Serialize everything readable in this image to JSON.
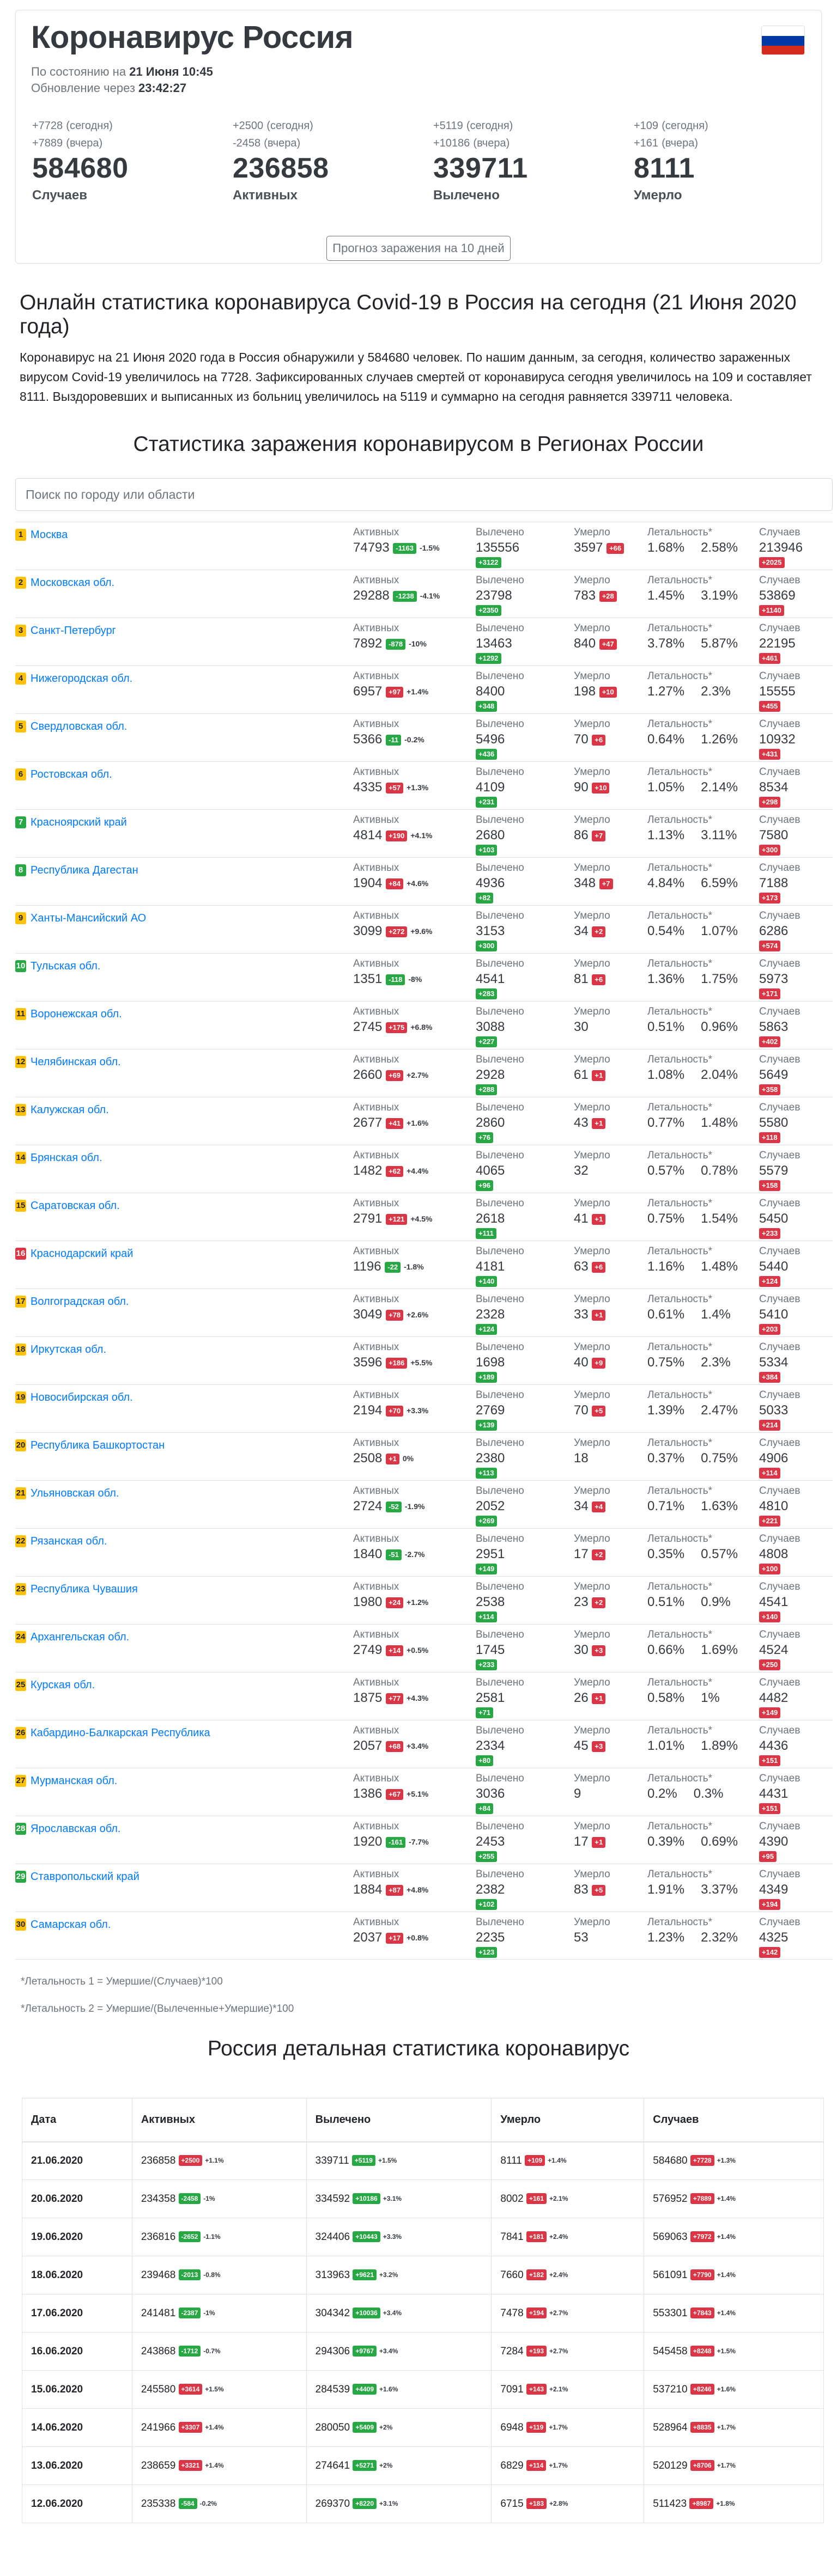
{
  "header": {
    "title": "Коронавирус Россия",
    "asof_label": "По состоянию на",
    "asof_value": "21 Июня 10:45",
    "update_label": "Обновление через",
    "update_value": "23:42:27"
  },
  "stats": [
    {
      "today": "+7728",
      "today_lbl": "(сегодня)",
      "yest": "+7889",
      "yest_lbl": "(вчера)",
      "total": "584680",
      "label": "Случаев",
      "color": "#212529"
    },
    {
      "today": "+2500",
      "today_lbl": "(сегодня)",
      "yest": "-2458",
      "yest_lbl": "(вчера)",
      "total": "236858",
      "label": "Активных",
      "color": "#17a2b8"
    },
    {
      "today": "+5119",
      "today_lbl": "(сегодня)",
      "yest": "+10186",
      "yest_lbl": "(вчера)",
      "total": "339711",
      "label": "Вылечено",
      "color": "#28a745"
    },
    {
      "today": "+109",
      "today_lbl": "(сегодня)",
      "yest": "+161",
      "yest_lbl": "(вчера)",
      "total": "8111",
      "label": "Умерло",
      "color": "#dc3545"
    }
  ],
  "forecast_button": "Прогноз заражения на 10 дней",
  "online_title": "Онлайн статистика коронавируса Covid-19 в Россия на сегодня (21 Июня 2020 года)",
  "intro": "Коронавирус на 21 Июня 2020 года в Россия обнаружили у 584680 человек. По нашим данным, за сегодня, количество зараженных вирусом Covid-19 увеличилось на 7728. Зафиксированных случаев смертей от коронавируса сегодня увеличилось на 109 и составляет 8111. Выздоровевших и выписанных из больниц увеличилось на 5119 и суммарно на сегодня равняется 339711 человека.",
  "regions_title": "Статистика заражения коронавирусом в Регионах России",
  "search_placeholder": "Поиск по городу или области",
  "col_labels": {
    "active": "Активных",
    "recovered": "Вылечено",
    "died": "Умерло",
    "lethality": "Летальность*",
    "cases": "Случаев"
  },
  "regions": [
    {
      "n": "1",
      "name": "Москва",
      "a": "74793",
      "ad": "-1163",
      "ap": "-1.5%",
      "r": "135556",
      "rd": "+3122",
      "d": "3597",
      "dd": "+66",
      "l1": "1.68%",
      "l2": "2.58%",
      "c": "213946",
      "cd": "+2025"
    },
    {
      "n": "2",
      "name": "Московская обл.",
      "a": "29288",
      "ad": "-1238",
      "ap": "-4.1%",
      "r": "23798",
      "rd": "+2350",
      "d": "783",
      "dd": "+28",
      "l1": "1.45%",
      "l2": "3.19%",
      "c": "53869",
      "cd": "+1140"
    },
    {
      "n": "3",
      "name": "Санкт-Петербург",
      "a": "7892",
      "ad": "-878",
      "ap": "-10%",
      "r": "13463",
      "rd": "+1292",
      "d": "840",
      "dd": "+47",
      "l1": "3.78%",
      "l2": "5.87%",
      "c": "22195",
      "cd": "+461"
    },
    {
      "n": "4",
      "name": "Нижегородская обл.",
      "a": "6957",
      "ad": "+97",
      "ap": "+1.4%",
      "r": "8400",
      "rd": "+348",
      "d": "198",
      "dd": "+10",
      "l1": "1.27%",
      "l2": "2.3%",
      "c": "15555",
      "cd": "+455"
    },
    {
      "n": "5",
      "name": "Свердловская обл.",
      "a": "5366",
      "ad": "-11",
      "ap": "-0.2%",
      "r": "5496",
      "rd": "+436",
      "d": "70",
      "dd": "+6",
      "l1": "0.64%",
      "l2": "1.26%",
      "c": "10932",
      "cd": "+431"
    },
    {
      "n": "6",
      "name": "Ростовская обл.",
      "a": "4335",
      "ad": "+57",
      "ap": "+1.3%",
      "r": "4109",
      "rd": "+231",
      "d": "90",
      "dd": "+10",
      "l1": "1.05%",
      "l2": "2.14%",
      "c": "8534",
      "cd": "+298"
    },
    {
      "n": "7",
      "name": "Красноярский край",
      "a": "4814",
      "ad": "+190",
      "ap": "+4.1%",
      "r": "2680",
      "rd": "+103",
      "d": "86",
      "dd": "+7",
      "l1": "1.13%",
      "l2": "3.11%",
      "c": "7580",
      "cd": "+300"
    },
    {
      "n": "8",
      "name": "Республика Дагестан",
      "a": "1904",
      "ad": "+84",
      "ap": "+4.6%",
      "r": "4936",
      "rd": "+82",
      "d": "348",
      "dd": "+7",
      "l1": "4.84%",
      "l2": "6.59%",
      "c": "7188",
      "cd": "+173"
    },
    {
      "n": "9",
      "name": "Ханты-Мансийский АО",
      "a": "3099",
      "ad": "+272",
      "ap": "+9.6%",
      "r": "3153",
      "rd": "+300",
      "d": "34",
      "dd": "+2",
      "l1": "0.54%",
      "l2": "1.07%",
      "c": "6286",
      "cd": "+574"
    },
    {
      "n": "10",
      "name": "Тульская обл.",
      "a": "1351",
      "ad": "-118",
      "ap": "-8%",
      "r": "4541",
      "rd": "+283",
      "d": "81",
      "dd": "+6",
      "l1": "1.36%",
      "l2": "1.75%",
      "c": "5973",
      "cd": "+171"
    },
    {
      "n": "11",
      "name": "Воронежская обл.",
      "a": "2745",
      "ad": "+175",
      "ap": "+6.8%",
      "r": "3088",
      "rd": "+227",
      "d": "30",
      "dd": "",
      "l1": "0.51%",
      "l2": "0.96%",
      "c": "5863",
      "cd": "+402"
    },
    {
      "n": "12",
      "name": "Челябинская обл.",
      "a": "2660",
      "ad": "+69",
      "ap": "+2.7%",
      "r": "2928",
      "rd": "+288",
      "d": "61",
      "dd": "+1",
      "l1": "1.08%",
      "l2": "2.04%",
      "c": "5649",
      "cd": "+358"
    },
    {
      "n": "13",
      "name": "Калужская обл.",
      "a": "2677",
      "ad": "+41",
      "ap": "+1.6%",
      "r": "2860",
      "rd": "+76",
      "d": "43",
      "dd": "+1",
      "l1": "0.77%",
      "l2": "1.48%",
      "c": "5580",
      "cd": "+118"
    },
    {
      "n": "14",
      "name": "Брянская обл.",
      "a": "1482",
      "ad": "+62",
      "ap": "+4.4%",
      "r": "4065",
      "rd": "+96",
      "d": "32",
      "dd": "",
      "l1": "0.57%",
      "l2": "0.78%",
      "c": "5579",
      "cd": "+158"
    },
    {
      "n": "15",
      "name": "Саратовская обл.",
      "a": "2791",
      "ad": "+121",
      "ap": "+4.5%",
      "r": "2618",
      "rd": "+111",
      "d": "41",
      "dd": "+1",
      "l1": "0.75%",
      "l2": "1.54%",
      "c": "5450",
      "cd": "+233"
    },
    {
      "n": "16",
      "name": "Краснодарский край",
      "a": "1196",
      "ad": "-22",
      "ap": "-1.8%",
      "r": "4181",
      "rd": "+140",
      "d": "63",
      "dd": "+6",
      "l1": "1.16%",
      "l2": "1.48%",
      "c": "5440",
      "cd": "+124"
    },
    {
      "n": "17",
      "name": "Волгоградская обл.",
      "a": "3049",
      "ad": "+78",
      "ap": "+2.6%",
      "r": "2328",
      "rd": "+124",
      "d": "33",
      "dd": "+1",
      "l1": "0.61%",
      "l2": "1.4%",
      "c": "5410",
      "cd": "+203"
    },
    {
      "n": "18",
      "name": "Иркутская обл.",
      "a": "3596",
      "ad": "+186",
      "ap": "+5.5%",
      "r": "1698",
      "rd": "+189",
      "d": "40",
      "dd": "+9",
      "l1": "0.75%",
      "l2": "2.3%",
      "c": "5334",
      "cd": "+384"
    },
    {
      "n": "19",
      "name": "Новосибирская обл.",
      "a": "2194",
      "ad": "+70",
      "ap": "+3.3%",
      "r": "2769",
      "rd": "+139",
      "d": "70",
      "dd": "+5",
      "l1": "1.39%",
      "l2": "2.47%",
      "c": "5033",
      "cd": "+214"
    },
    {
      "n": "20",
      "name": "Республика Башкортостан",
      "a": "2508",
      "ad": "+1",
      "ap": "0%",
      "r": "2380",
      "rd": "+113",
      "d": "18",
      "dd": "",
      "l1": "0.37%",
      "l2": "0.75%",
      "c": "4906",
      "cd": "+114"
    },
    {
      "n": "21",
      "name": "Ульяновская обл.",
      "a": "2724",
      "ad": "-52",
      "ap": "-1.9%",
      "r": "2052",
      "rd": "+269",
      "d": "34",
      "dd": "+4",
      "l1": "0.71%",
      "l2": "1.63%",
      "c": "4810",
      "cd": "+221"
    },
    {
      "n": "22",
      "name": "Рязанская обл.",
      "a": "1840",
      "ad": "-51",
      "ap": "-2.7%",
      "r": "2951",
      "rd": "+149",
      "d": "17",
      "dd": "+2",
      "l1": "0.35%",
      "l2": "0.57%",
      "c": "4808",
      "cd": "+100"
    },
    {
      "n": "23",
      "name": "Республика Чувашия",
      "a": "1980",
      "ad": "+24",
      "ap": "+1.2%",
      "r": "2538",
      "rd": "+114",
      "d": "23",
      "dd": "+2",
      "l1": "0.51%",
      "l2": "0.9%",
      "c": "4541",
      "cd": "+140"
    },
    {
      "n": "24",
      "name": "Архангельская обл.",
      "a": "2749",
      "ad": "+14",
      "ap": "+0.5%",
      "r": "1745",
      "rd": "+233",
      "d": "30",
      "dd": "+3",
      "l1": "0.66%",
      "l2": "1.69%",
      "c": "4524",
      "cd": "+250"
    },
    {
      "n": "25",
      "name": "Курская обл.",
      "a": "1875",
      "ad": "+77",
      "ap": "+4.3%",
      "r": "2581",
      "rd": "+71",
      "d": "26",
      "dd": "+1",
      "l1": "0.58%",
      "l2": "1%",
      "c": "4482",
      "cd": "+149"
    },
    {
      "n": "26",
      "name": "Кабардино-Балкарская Республика",
      "a": "2057",
      "ad": "+68",
      "ap": "+3.4%",
      "r": "2334",
      "rd": "+80",
      "d": "45",
      "dd": "+3",
      "l1": "1.01%",
      "l2": "1.89%",
      "c": "4436",
      "cd": "+151"
    },
    {
      "n": "27",
      "name": "Мурманская обл.",
      "a": "1386",
      "ad": "+67",
      "ap": "+5.1%",
      "r": "3036",
      "rd": "+84",
      "d": "9",
      "dd": "",
      "l1": "0.2%",
      "l2": "0.3%",
      "c": "4431",
      "cd": "+151"
    },
    {
      "n": "28",
      "name": "Ярославская обл.",
      "a": "1920",
      "ad": "-161",
      "ap": "-7.7%",
      "r": "2453",
      "rd": "+255",
      "d": "17",
      "dd": "+1",
      "l1": "0.39%",
      "l2": "0.69%",
      "c": "4390",
      "cd": "+95"
    },
    {
      "n": "29",
      "name": "Ставропольский край",
      "a": "1884",
      "ad": "+87",
      "ap": "+4.8%",
      "r": "2382",
      "rd": "+102",
      "d": "83",
      "dd": "+5",
      "l1": "1.91%",
      "l2": "3.37%",
      "c": "4349",
      "cd": "+194"
    },
    {
      "n": "30",
      "name": "Самарская обл.",
      "a": "2037",
      "ad": "+17",
      "ap": "+0.8%",
      "r": "2235",
      "rd": "+123",
      "d": "53",
      "dd": "",
      "l1": "1.23%",
      "l2": "2.32%",
      "c": "4325",
      "cd": "+142"
    }
  ],
  "footnote1": "*Летальность 1 = Умершие/(Случаев)*100",
  "footnote2": "*Летальность 2 = Умершие/(Вылеченные+Умершие)*100",
  "detail_title": "Россия детальная статистика коронавирус",
  "detail_headers": [
    "Дата",
    "Активных",
    "Вылечено",
    "Умерло",
    "Случаев"
  ],
  "detail_rows": [
    {
      "date": "21.06.2020",
      "a": "236858",
      "ad": "+2500",
      "ap": "+1.1%",
      "r": "339711",
      "rd": "+5119",
      "rp": "+1.5%",
      "d": "8111",
      "dd": "+109",
      "dp": "+1.4%",
      "c": "584680",
      "cd": "+7728",
      "cp": "+1.3%"
    },
    {
      "date": "20.06.2020",
      "a": "234358",
      "ad": "-2458",
      "ap": "-1%",
      "r": "334592",
      "rd": "+10186",
      "rp": "+3.1%",
      "d": "8002",
      "dd": "+161",
      "dp": "+2.1%",
      "c": "576952",
      "cd": "+7889",
      "cp": "+1.4%"
    },
    {
      "date": "19.06.2020",
      "a": "236816",
      "ad": "-2652",
      "ap": "-1.1%",
      "r": "324406",
      "rd": "+10443",
      "rp": "+3.3%",
      "d": "7841",
      "dd": "+181",
      "dp": "+2.4%",
      "c": "569063",
      "cd": "+7972",
      "cp": "+1.4%"
    },
    {
      "date": "18.06.2020",
      "a": "239468",
      "ad": "-2013",
      "ap": "-0.8%",
      "r": "313963",
      "rd": "+9621",
      "rp": "+3.2%",
      "d": "7660",
      "dd": "+182",
      "dp": "+2.4%",
      "c": "561091",
      "cd": "+7790",
      "cp": "+1.4%"
    },
    {
      "date": "17.06.2020",
      "a": "241481",
      "ad": "-2387",
      "ap": "-1%",
      "r": "304342",
      "rd": "+10036",
      "rp": "+3.4%",
      "d": "7478",
      "dd": "+194",
      "dp": "+2.7%",
      "c": "553301",
      "cd": "+7843",
      "cp": "+1.4%"
    },
    {
      "date": "16.06.2020",
      "a": "243868",
      "ad": "-1712",
      "ap": "-0.7%",
      "r": "294306",
      "rd": "+9767",
      "rp": "+3.4%",
      "d": "7284",
      "dd": "+193",
      "dp": "+2.7%",
      "c": "545458",
      "cd": "+8248",
      "cp": "+1.5%"
    },
    {
      "date": "15.06.2020",
      "a": "245580",
      "ad": "+3614",
      "ap": "+1.5%",
      "r": "284539",
      "rd": "+4409",
      "rp": "+1.6%",
      "d": "7091",
      "dd": "+143",
      "dp": "+2.1%",
      "c": "537210",
      "cd": "+8246",
      "cp": "+1.6%"
    },
    {
      "date": "14.06.2020",
      "a": "241966",
      "ad": "+3307",
      "ap": "+1.4%",
      "r": "280050",
      "rd": "+5409",
      "rp": "+2%",
      "d": "6948",
      "dd": "+119",
      "dp": "+1.7%",
      "c": "528964",
      "cd": "+8835",
      "cp": "+1.7%"
    },
    {
      "date": "13.06.2020",
      "a": "238659",
      "ad": "+3321",
      "ap": "+1.4%",
      "r": "274641",
      "rd": "+5271",
      "rp": "+2%",
      "d": "6829",
      "dd": "+114",
      "dp": "+1.7%",
      "c": "520129",
      "cd": "+8706",
      "cp": "+1.7%"
    },
    {
      "date": "12.06.2020",
      "a": "235338",
      "ad": "-584",
      "ap": "-0.2%",
      "r": "269370",
      "rd": "+8220",
      "rp": "+3.1%",
      "d": "6715",
      "dd": "+183",
      "dp": "+2.8%",
      "c": "511423",
      "cd": "+8987",
      "cp": "+1.8%"
    }
  ],
  "colors": {
    "link": "#007bff",
    "green": "#28a745",
    "red": "#dc3545",
    "yellow": "#ffc107",
    "cyan": "#17a2b8"
  }
}
